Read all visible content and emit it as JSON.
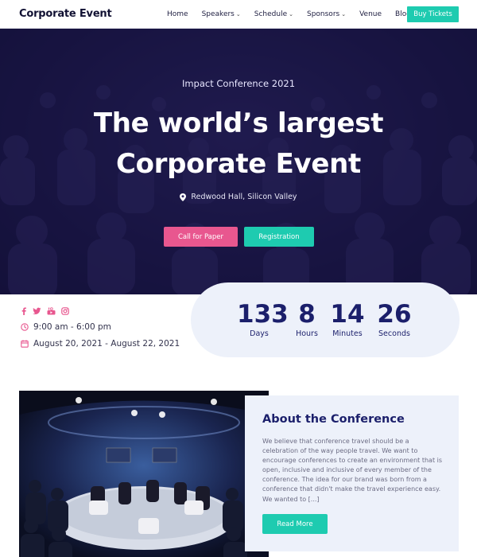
{
  "brand": "Corporate Event",
  "nav": {
    "items": [
      {
        "label": "Home",
        "dropdown": false
      },
      {
        "label": "Speakers",
        "dropdown": true
      },
      {
        "label": "Schedule",
        "dropdown": true
      },
      {
        "label": "Sponsors",
        "dropdown": true
      },
      {
        "label": "Venue",
        "dropdown": false
      },
      {
        "label": "Blog",
        "dropdown": false
      }
    ],
    "buy_label": "Buy Tickets"
  },
  "hero": {
    "subtitle": "Impact Conference 2021",
    "title_line1": "The world’s largest",
    "title_line2": "Corporate Event",
    "location": "Redwood Hall, Silicon Valley",
    "btn_paper": "Call for Paper",
    "btn_registration": "Registration"
  },
  "info": {
    "social_icons": [
      "facebook-icon",
      "twitter-icon",
      "youtube-icon",
      "instagram-icon"
    ],
    "time": "9:00 am - 6:00 pm",
    "dates": "August 20, 2021 - August 22, 2021"
  },
  "countdown": [
    {
      "value": "133",
      "label": "Days"
    },
    {
      "value": "8",
      "label": "Hours"
    },
    {
      "value": "14",
      "label": "Minutes"
    },
    {
      "value": "26",
      "label": "Seconds"
    }
  ],
  "about": {
    "title": "About the Conference",
    "text": "We believe that conference travel should be a celebration of the way people travel. We want to encourage conferences to create an environment that is open, inclusive and inclusive of every member of the conference. The idea for our brand was born from a conference that didn't make the travel experience easy. We wanted to [...]",
    "button": "Read More"
  },
  "colors": {
    "accent_teal": "#1ecbb0",
    "accent_pink": "#e8578f",
    "navy": "#1b1f6b",
    "hero_bg": "#1c1846",
    "panel_bg": "#edf1fa"
  }
}
